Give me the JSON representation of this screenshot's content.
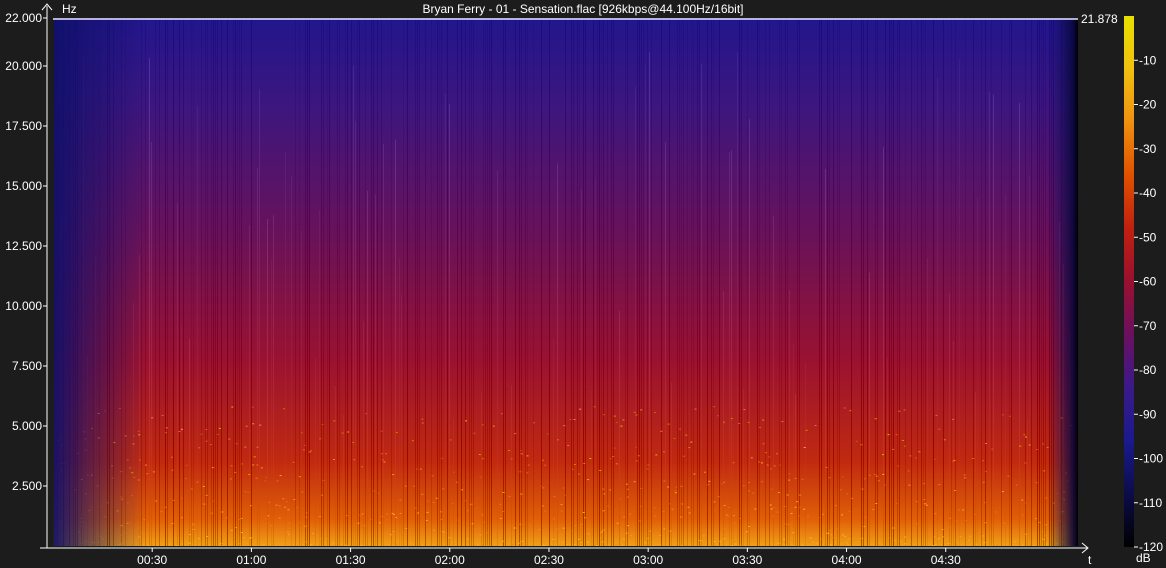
{
  "chart_data": {
    "type": "heatmap",
    "title": "Bryan Ferry - 01 - Sensation.flac [926kbps@44.100Hz/16bit]",
    "y_unit": "Hz",
    "x_unit": "t",
    "colorbar_unit": "dB",
    "ylim": [
      0,
      22000
    ],
    "y_ticks": [
      "2.500",
      "5.000",
      "7.500",
      "10.000",
      "12.500",
      "15.000",
      "17.500",
      "20.000",
      "22.000"
    ],
    "y_tick_values": [
      2500,
      5000,
      7500,
      10000,
      12500,
      15000,
      17500,
      20000,
      22000
    ],
    "x_ticks": [
      "00:30",
      "01:00",
      "01:30",
      "02:00",
      "02:30",
      "03:00",
      "03:30",
      "04:00",
      "04:30"
    ],
    "x_tick_values": [
      30,
      60,
      90,
      120,
      150,
      180,
      210,
      240,
      270
    ],
    "duration_seconds": 310,
    "cutoff_frequency_label": "21.878",
    "cutoff_frequency": 21878,
    "colorbar_ticks": [
      "-10",
      "-20",
      "-30",
      "-40",
      "-50",
      "-60",
      "-70",
      "-80",
      "-90",
      "-100",
      "-110",
      "-120"
    ],
    "colorbar_tick_values": [
      -10,
      -20,
      -30,
      -40,
      -50,
      -60,
      -70,
      -80,
      -90,
      -100,
      -110,
      -120
    ],
    "colorbar_range": [
      -120,
      0
    ],
    "colormap": [
      "#000000",
      "#0c0c4a",
      "#1a1a8c",
      "#3a1a8a",
      "#6a1060",
      "#9a1030",
      "#c02010",
      "#e05000",
      "#f09010",
      "#f0c010",
      "#e8e000"
    ],
    "grid": false
  },
  "colors": {
    "background": "#1c1c1c",
    "axis": "#ffffff",
    "cutoff_line": "#e8e8ff"
  }
}
